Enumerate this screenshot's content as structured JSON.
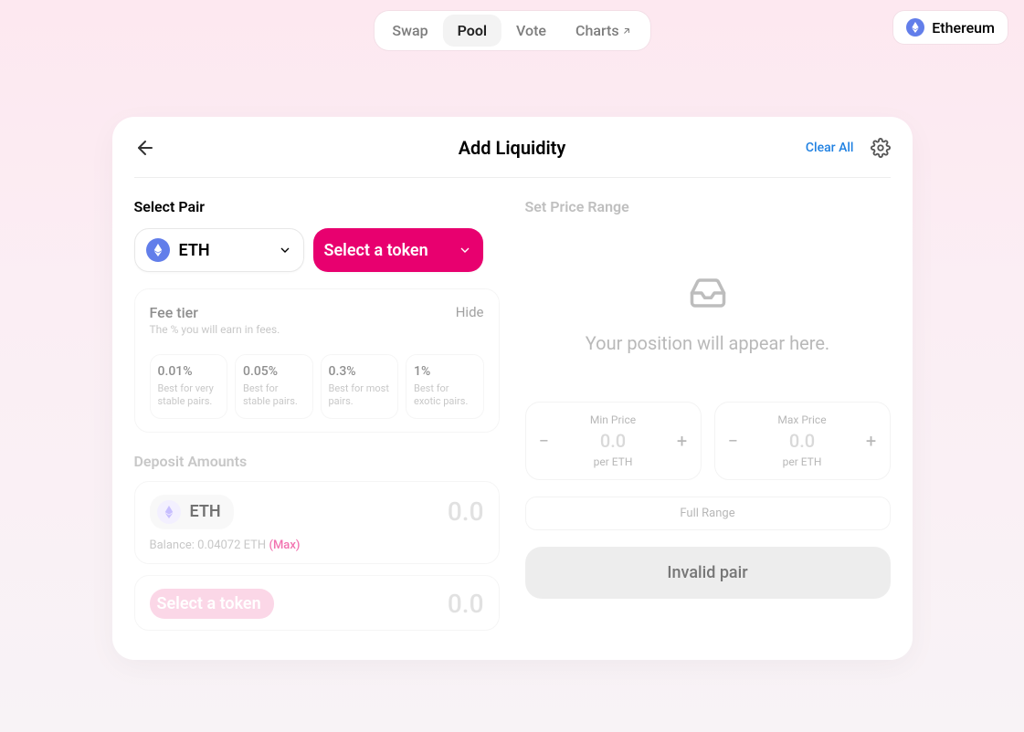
{
  "nav": {
    "items": [
      "Swap",
      "Pool",
      "Vote",
      "Charts"
    ],
    "active": "Pool",
    "charts_external": true
  },
  "network": {
    "name": "Ethereum"
  },
  "card": {
    "title": "Add Liquidity",
    "clear": "Clear All"
  },
  "left": {
    "section": "Select Pair",
    "tokenA": {
      "symbol": "ETH"
    },
    "tokenB": {
      "label": "Select a token"
    },
    "fee": {
      "title": "Fee tier",
      "subtitle": "The % you will earn in fees.",
      "toggle": "Hide",
      "options": [
        {
          "pct": "0.01%",
          "desc": "Best for very stable pairs."
        },
        {
          "pct": "0.05%",
          "desc": "Best for stable pairs."
        },
        {
          "pct": "0.3%",
          "desc": "Best for most pairs."
        },
        {
          "pct": "1%",
          "desc": "Best for exotic pairs."
        }
      ]
    },
    "deposit": {
      "label": "Deposit Amounts",
      "tokenA": {
        "symbol": "ETH",
        "amount": "0.0",
        "balance": "Balance: 0.04072 ETH",
        "max": "(Max)"
      },
      "tokenB": {
        "label": "Select a token",
        "amount": "0.0"
      }
    }
  },
  "right": {
    "section": "Set Price Range",
    "placeholder": "Your position will appear here.",
    "min": {
      "label": "Min Price",
      "value": "0.0",
      "per": "per ETH"
    },
    "max": {
      "label": "Max Price",
      "value": "0.0",
      "per": "per ETH"
    },
    "full_range": "Full Range",
    "submit": "Invalid pair"
  }
}
